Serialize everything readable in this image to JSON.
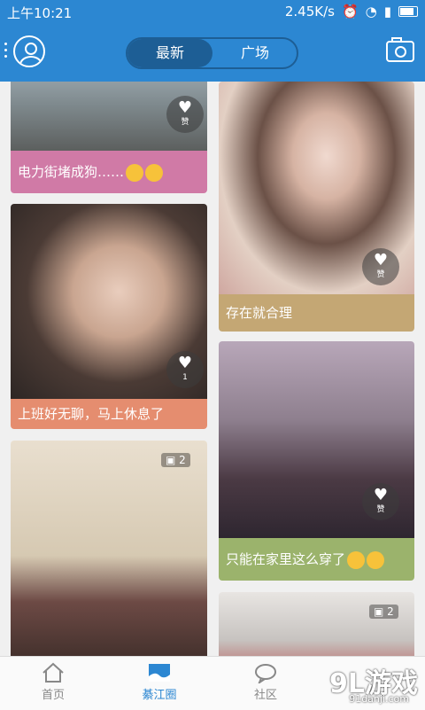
{
  "status_bar": {
    "time": "上午10:21",
    "speed": "2.45K/s"
  },
  "header": {
    "tabs": [
      {
        "label": "最新",
        "active": true
      },
      {
        "label": "广场",
        "active": false
      }
    ]
  },
  "feed": {
    "cards": [
      {
        "caption": "电力街堵成狗……",
        "caption_color": "#d07aa6",
        "like_text": "赞"
      },
      {
        "caption": "存在就合理",
        "caption_color": "#c4a774",
        "like_text": "赞"
      },
      {
        "caption": "上班好无聊，马上休息了",
        "caption_color": "#e58d6f",
        "like_text": "1"
      },
      {
        "caption": "只能在家里这么穿了",
        "caption_color": "#9bb36c",
        "like_text": "赞"
      },
      {
        "image_count": "2"
      },
      {
        "image_count": "2"
      }
    ]
  },
  "bottom_nav": {
    "items": [
      {
        "label": "首页"
      },
      {
        "label": "綦江圈",
        "active": true
      },
      {
        "label": "社区"
      }
    ]
  },
  "watermark": {
    "logo": "9L游戏",
    "site": "91danji.com"
  },
  "colors": {
    "primary": "#2c87d2",
    "primary_dark": "#1d5e95"
  }
}
